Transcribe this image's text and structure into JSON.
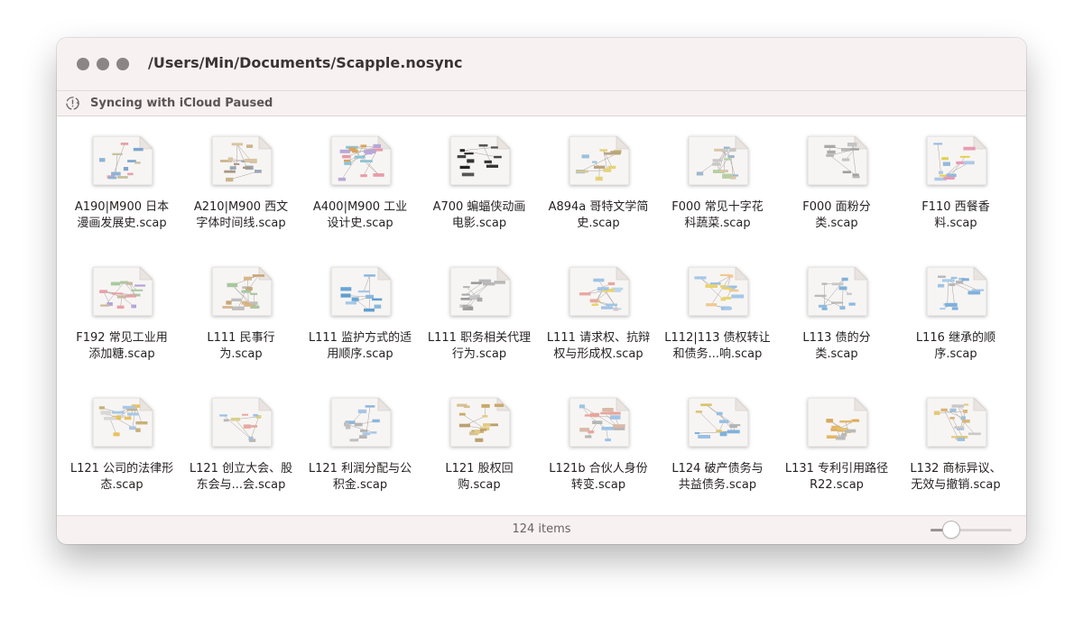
{
  "window": {
    "path_title": "/Users/Min/Documents/Scapple.nosync"
  },
  "sync_bar": {
    "icon": "icloud-sync-paused-icon",
    "text": "Syncing with iCloud Paused"
  },
  "files": [
    {
      "line1": "A190|M900 日本",
      "line2": "漫画发展史.scap"
    },
    {
      "line1": "A210|M900 西文",
      "line2": "字体时间线.scap"
    },
    {
      "line1": "A400|M900 工业",
      "line2": "设计史.scap"
    },
    {
      "line1": "A700 蝙蝠侠动画",
      "line2": "电影.scap"
    },
    {
      "line1": "A894a 哥特文学简",
      "line2": "史.scap"
    },
    {
      "line1": "F000 常见十字花",
      "line2": "科蔬菜.scap"
    },
    {
      "line1": "F000 面粉分",
      "line2": "类.scap"
    },
    {
      "line1": "F110 西餐香",
      "line2": "料.scap"
    },
    {
      "line1": "F192 常见工业用",
      "line2": "添加糖.scap"
    },
    {
      "line1": "L111 民事行",
      "line2": "为.scap"
    },
    {
      "line1": "L111 监护方式的适",
      "line2": "用顺序.scap"
    },
    {
      "line1": "L111 职务相关代理",
      "line2": "行为.scap"
    },
    {
      "line1": "L111 请求权、抗辩",
      "line2": "权与形成权.scap"
    },
    {
      "line1": "L112|113 债权转让",
      "line2": "和债务...响.scap"
    },
    {
      "line1": "L113 债的分",
      "line2": "类.scap"
    },
    {
      "line1": "L116 继承的顺",
      "line2": "序.scap"
    },
    {
      "line1": "L121 公司的法律形",
      "line2": "态.scap"
    },
    {
      "line1": "L121 创立大会、股",
      "line2": "东会与...会.scap"
    },
    {
      "line1": "L121 利润分配与公",
      "line2": "积金.scap"
    },
    {
      "line1": "L121 股权回",
      "line2": "购.scap"
    },
    {
      "line1": "L121b 合伙人身份",
      "line2": "转变.scap"
    },
    {
      "line1": "L124 破产债务与",
      "line2": "共益债务.scap"
    },
    {
      "line1": "L131 专利引用路径",
      "line2": "R22.scap"
    },
    {
      "line1": "L132 商标异议、",
      "line2": "无效与撤销.scap"
    }
  ],
  "status_bar": {
    "item_count": "124 items",
    "icon_size_slider": 0.2
  },
  "colors": {
    "chrome_background": "#f7f1f1",
    "traffic_light": "#8c8585",
    "title_text": "#3a3434"
  }
}
